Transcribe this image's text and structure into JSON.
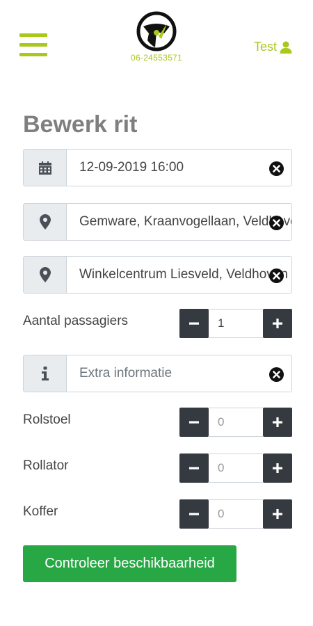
{
  "header": {
    "phone": "06-24553571",
    "user_name": "Test",
    "accent_color": "#a8c81c"
  },
  "page": {
    "title": "Bewerk rit"
  },
  "fields": {
    "datetime": {
      "value": "12-09-2019 16:00",
      "icon": "calendar-icon"
    },
    "pickup": {
      "value": "Gemware, Kraanvogellaan, Veldhoven",
      "icon": "map-marker-icon"
    },
    "destination": {
      "value": "Winkelcentrum Liesveld, Veldhoven",
      "icon": "map-marker-icon"
    },
    "extra_info": {
      "placeholder": "Extra informatie",
      "icon": "info-icon"
    }
  },
  "counters": {
    "passengers": {
      "label": "Aantal passagiers",
      "value": "1"
    },
    "wheelchair": {
      "label": "Rolstoel",
      "value": "0"
    },
    "rollator": {
      "label": "Rollator",
      "value": "0"
    },
    "suitcase": {
      "label": "Koffer",
      "value": "0"
    }
  },
  "actions": {
    "check_label": "Controleer beschikbaarheid",
    "check_color": "#28a745"
  }
}
